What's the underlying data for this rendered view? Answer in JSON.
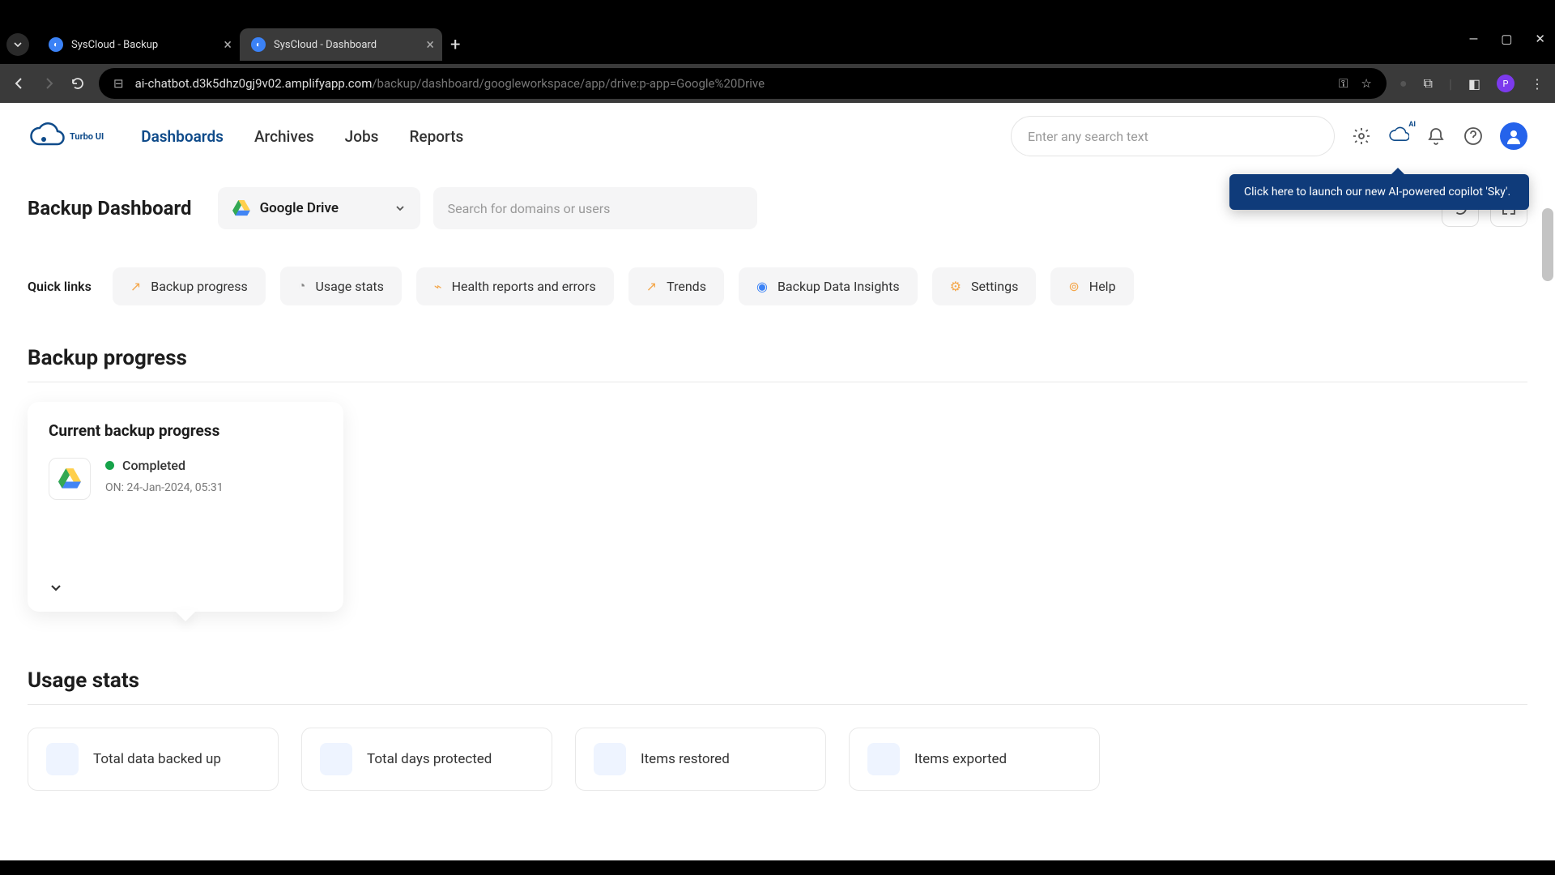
{
  "browser": {
    "tabs": [
      {
        "title": "SysCloud - Backup",
        "active": false
      },
      {
        "title": "SysCloud - Dashboard",
        "active": true
      }
    ],
    "url_host": "ai-chatbot.d3k5dhz0gj9v02.amplifyapp.com",
    "url_path": "/backup/dashboard/googleworkspace/app/drive:p-app=Google%20Drive",
    "profile_badge": "P"
  },
  "header": {
    "logo_text": "Turbo UI",
    "nav": [
      "Dashboards",
      "Archives",
      "Jobs",
      "Reports"
    ],
    "active_nav": "Dashboards",
    "search_placeholder": "Enter any search text",
    "ai_badge": "AI"
  },
  "tooltip": "Click here to launch our new AI-powered copilot 'Sky'.",
  "dash": {
    "title": "Backup Dashboard",
    "selector": "Google Drive",
    "domain_placeholder": "Search for domains or users"
  },
  "quicklinks": {
    "label": "Quick links",
    "items": [
      "Backup progress",
      "Usage stats",
      "Health reports and errors",
      "Trends",
      "Backup Data Insights",
      "Settings",
      "Help"
    ]
  },
  "sections": {
    "backup_progress": "Backup progress",
    "usage_stats": "Usage stats"
  },
  "progress_card": {
    "title": "Current backup progress",
    "status": "Completed",
    "date": "ON: 24-Jan-2024, 05:31"
  },
  "stats": [
    "Total data backed up",
    "Total days protected",
    "Items restored",
    "Items exported"
  ]
}
